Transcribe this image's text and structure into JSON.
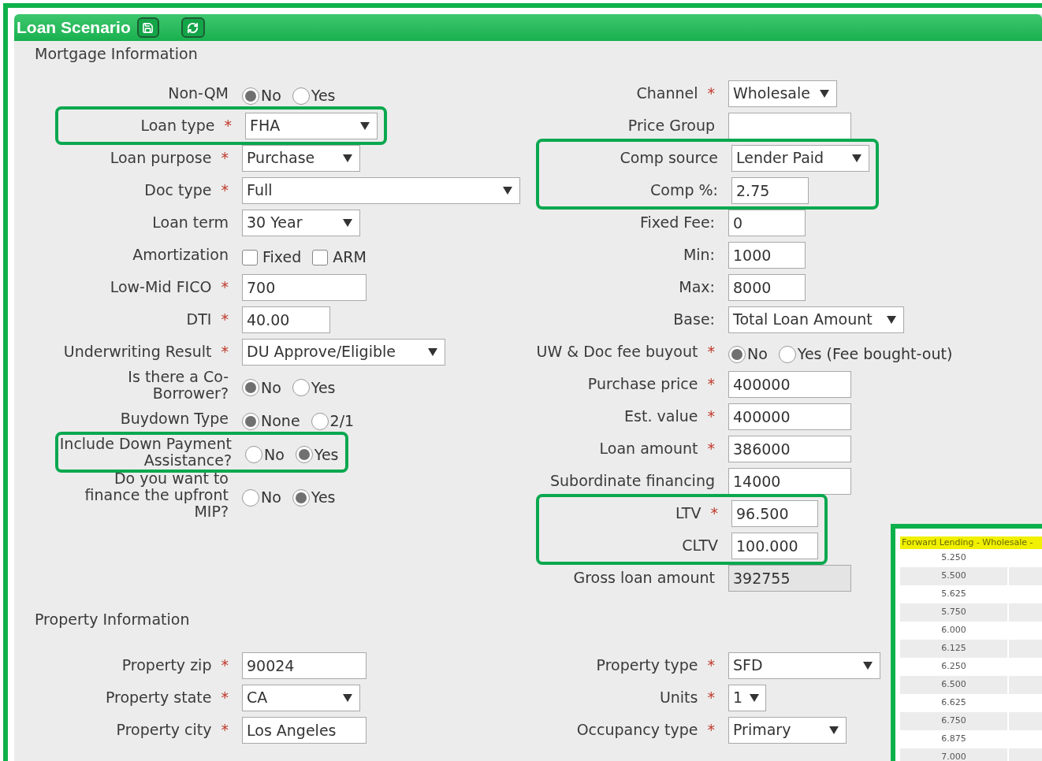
{
  "panel": {
    "title": "Loan Scenario"
  },
  "sections": [
    {
      "title": "Mortgage Information",
      "left": [
        {
          "label": "Non-QM",
          "kind": "radio",
          "options": [
            {
              "label": "No",
              "selected": true
            },
            {
              "label": "Yes",
              "selected": false
            }
          ]
        },
        {
          "label": "Loan type",
          "mark": "*",
          "kind": "select",
          "value": "FHA",
          "highlighted": true
        },
        {
          "label": "Loan purpose",
          "mark": "*",
          "kind": "select",
          "value": "Purchase"
        },
        {
          "label": "Doc type",
          "mark": "*",
          "kind": "select",
          "value": "Full"
        },
        {
          "label": "Loan term",
          "kind": "select",
          "value": "30 Year"
        },
        {
          "label": "Amortization",
          "kind": "checkbox",
          "options": [
            {
              "label": "Fixed",
              "checked": false
            },
            {
              "label": "ARM",
              "checked": false
            }
          ]
        },
        {
          "label": "Low-Mid FICO",
          "mark": "*",
          "kind": "text",
          "value": "700"
        },
        {
          "label": "DTI",
          "mark": "*",
          "kind": "text",
          "value": "40.00"
        },
        {
          "label": "Underwriting Result",
          "mark": "*",
          "kind": "select",
          "value": "DU Approve/Eligible"
        },
        {
          "label": "Is there a Co-Borrower?",
          "kind": "radio",
          "options": [
            {
              "label": "No",
              "selected": true
            },
            {
              "label": "Yes",
              "selected": false
            }
          ]
        },
        {
          "label": "Buydown Type",
          "kind": "radio",
          "options": [
            {
              "label": "None",
              "selected": true
            },
            {
              "label": "2/1",
              "selected": false
            }
          ]
        },
        {
          "label": "Include Down Payment Assistance?",
          "kind": "radio",
          "options": [
            {
              "label": "No",
              "selected": false
            },
            {
              "label": "Yes",
              "selected": true
            }
          ],
          "highlighted": true
        },
        {
          "label": "Do you want to finance the upfront MIP?",
          "kind": "radio",
          "options": [
            {
              "label": "No",
              "selected": false
            },
            {
              "label": "Yes",
              "selected": true
            }
          ]
        }
      ],
      "right": [
        {
          "label": "Channel",
          "mark": "*",
          "kind": "select",
          "value": "Wholesale"
        },
        {
          "label": "Price Group",
          "kind": "text"
        },
        {
          "label": "Comp source",
          "kind": "select",
          "value": "Lender Paid",
          "highlighted": true
        },
        {
          "label": "Comp %:",
          "kind": "text",
          "value": "2.75",
          "highlighted": true
        },
        {
          "label": "Fixed Fee:",
          "kind": "text",
          "value": "0"
        },
        {
          "label": "Min:",
          "kind": "text",
          "value": "1000"
        },
        {
          "label": "Max:",
          "kind": "text",
          "value": "8000"
        },
        {
          "label": "Base:",
          "kind": "select",
          "value": "Total Loan Amount"
        },
        {
          "label": "UW & Doc fee buyout",
          "mark": "*",
          "kind": "radio",
          "options": [
            {
              "label": "No",
              "selected": true
            },
            {
              "label": "Yes (Fee bought-out)",
              "selected": false
            }
          ]
        },
        {
          "label": "Purchase price",
          "mark": "*",
          "kind": "text",
          "value": "400000"
        },
        {
          "label": "Est. value",
          "mark": "*",
          "kind": "text",
          "value": "400000"
        },
        {
          "label": "Loan amount",
          "mark": "*",
          "kind": "text",
          "value": "386000"
        },
        {
          "label": "Subordinate financing",
          "kind": "text",
          "value": "14000"
        },
        {
          "label": "LTV",
          "mark": "*",
          "kind": "text",
          "value": "96.500",
          "highlighted": true
        },
        {
          "label": "CLTV",
          "kind": "text",
          "value": "100.000",
          "highlighted": true
        },
        {
          "label": "Gross loan amount",
          "kind": "text",
          "value": "392755",
          "disabled": true
        }
      ]
    },
    {
      "title": "Property Information",
      "left": [
        {
          "label": "Property zip",
          "mark": "*",
          "kind": "text",
          "value": "90024"
        },
        {
          "label": "Property state",
          "mark": "*",
          "kind": "select",
          "value": "CA"
        },
        {
          "label": "Property city",
          "mark": "*",
          "kind": "text",
          "value": "Los Angeles"
        }
      ],
      "right": [
        {
          "label": "Property type",
          "mark": "*",
          "kind": "select",
          "value": "SFD"
        },
        {
          "label": "Units",
          "mark": "*",
          "kind": "select",
          "value": "1"
        },
        {
          "label": "Occupancy type",
          "mark": "*",
          "kind": "select",
          "value": "Primary"
        }
      ]
    }
  ],
  "rate_table": {
    "title": "Forward Lending - Wholesale -",
    "rows": [
      "5.250",
      "5.500",
      "5.625",
      "5.750",
      "6.000",
      "6.125",
      "6.250",
      "6.500",
      "6.625",
      "6.750",
      "6.875",
      "7.000"
    ]
  }
}
